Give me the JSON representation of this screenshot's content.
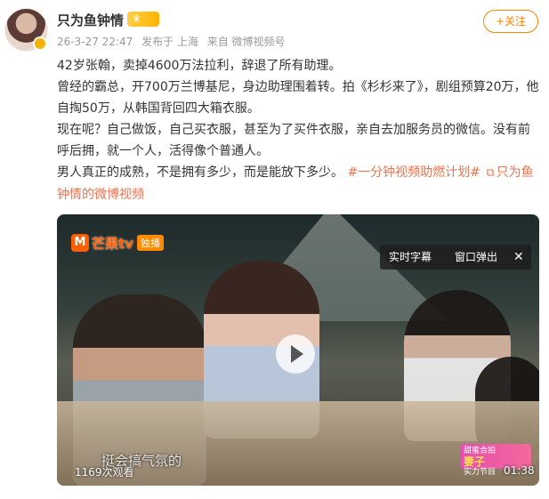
{
  "post": {
    "author": "只为鱼钟情",
    "level_label": "",
    "meta": {
      "date": "26-3-27 22:47",
      "location": "发布于 上海",
      "source": "来自 微博视频号"
    },
    "follow_label": "+关注",
    "content": {
      "line1": "42岁张翰，卖掉4600万法拉利，辞退了所有助理。",
      "line2": "曾经的霸总，开700万兰博基尼，身边助理围着转。拍《杉杉来了》，剧组预算20万，他自掏50万，从韩国背回四大箱衣服。",
      "line3": "现在呢？自己做饭，自己买衣服，甚至为了买件衣服，亲自去加服务员的微信。没有前呼后拥，就一个人，活得像个普通人。",
      "line4_text": "男人真正的成熟，不是拥有多少，而是能放下多少。",
      "topic": "#一分钟视频助燃计划#",
      "link_label": "只为鱼钟情的微博视频"
    }
  },
  "video": {
    "brand_text": "芒果tv",
    "brand_tag": "独播",
    "menu": {
      "subtitles": "实时字幕",
      "popout": "窗口弹出",
      "close": "✕"
    },
    "subtitle_text": "挺会搞气氛的",
    "views": "1169次观看",
    "duration": "01:38",
    "corner_logo_small": "甜蜜合拍",
    "corner_logo_big": "妻子",
    "corner_logo_sub": "实力节目"
  },
  "colors": {
    "accent": "#ff8200",
    "topic": "#eb7350",
    "meta": "#999999"
  }
}
